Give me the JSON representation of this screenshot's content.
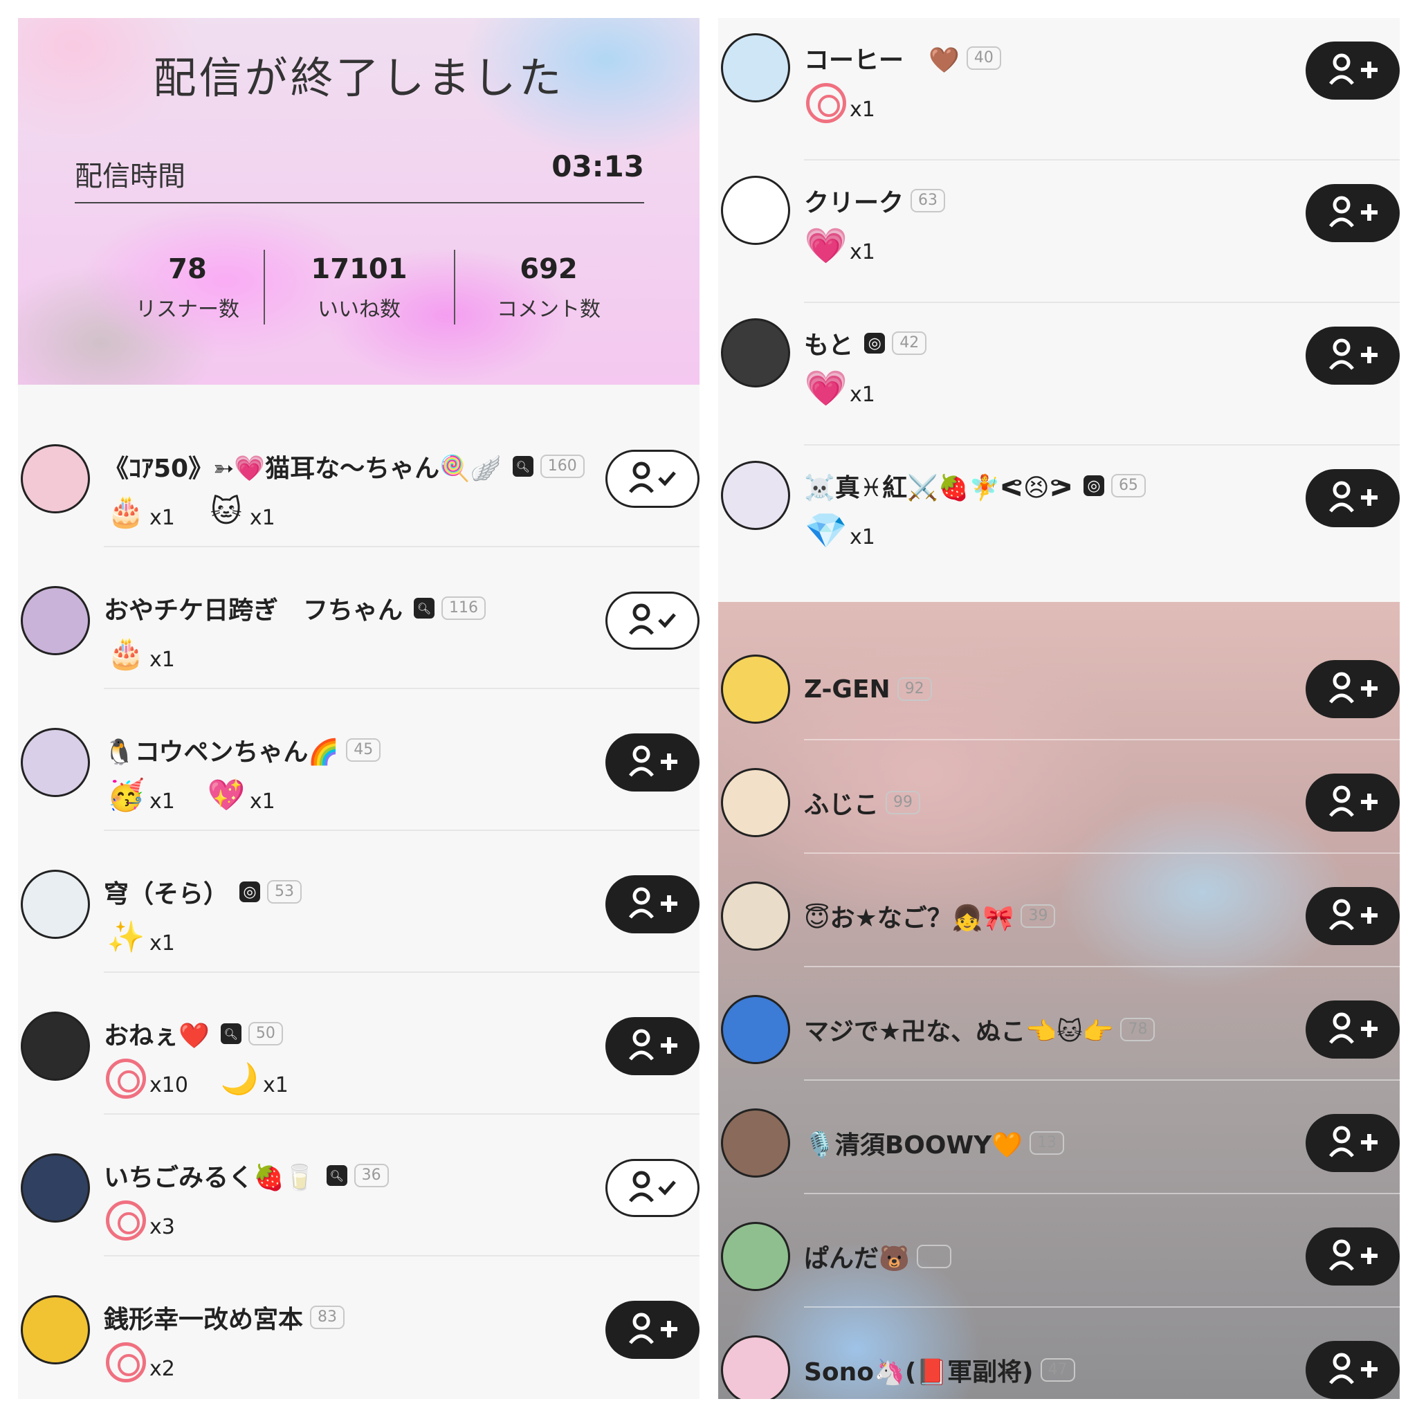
{
  "summary": {
    "title": "配信が終了しました",
    "duration_label": "配信時間",
    "duration_value": "03:13",
    "stats": [
      {
        "value": "78",
        "label": "リスナー数"
      },
      {
        "value": "17101",
        "label": "いいね数"
      },
      {
        "value": "692",
        "label": "コメント数"
      }
    ]
  },
  "left_listeners": [
    {
      "name": "《ｺｱ50》➳💗猫耳な～ちゃん🍭🪽",
      "badge": "Q",
      "level": "160",
      "following": true,
      "gifts": [
        {
          "icon": "🎂",
          "count": "x1"
        },
        {
          "icon": "🐱",
          "count": "x1"
        }
      ]
    },
    {
      "name": "おやチケ日跨ぎ　フちゃん",
      "badge": "Q",
      "level": "116",
      "following": true,
      "gifts": [
        {
          "icon": "🎂",
          "count": "x1"
        }
      ]
    },
    {
      "name": "🐧コウペンちゃん🌈",
      "badge": "",
      "level": "45",
      "following": false,
      "gifts": [
        {
          "icon": "🥳",
          "count": "x1"
        },
        {
          "icon": "💖",
          "count": "x1"
        }
      ]
    },
    {
      "name": "穹（そら）",
      "badge": "IG",
      "level": "53",
      "following": false,
      "gifts": [
        {
          "icon": "✨",
          "count": "x1"
        }
      ]
    },
    {
      "name": "おねぇ❤️",
      "badge": "Q",
      "level": "50",
      "following": false,
      "gifts": [
        {
          "icon": "rose",
          "count": "x10"
        },
        {
          "icon": "🌙",
          "count": "x1"
        }
      ]
    },
    {
      "name": "いちごみるく🍓🥛",
      "badge": "Q",
      "level": "36",
      "following": true,
      "gifts": [
        {
          "icon": "rose",
          "count": "x3"
        }
      ]
    },
    {
      "name": "銭形幸一改め宮本",
      "badge": "",
      "level": "83",
      "following": false,
      "gifts": [
        {
          "icon": "rose",
          "count": "x2"
        }
      ]
    }
  ],
  "right_listeners": [
    {
      "name": "コーヒー　🤎",
      "badge": "",
      "level": "40",
      "following": false,
      "gifts": [
        {
          "icon": "rose",
          "count": "x1"
        }
      ]
    },
    {
      "name": "クリーク",
      "badge": "",
      "level": "63",
      "following": false,
      "gifts": [
        {
          "icon": "💗",
          "count": "x1"
        }
      ]
    },
    {
      "name": "もと",
      "badge": "IG",
      "level": "42",
      "following": false,
      "gifts": [
        {
          "icon": "💗",
          "count": "x1"
        }
      ]
    },
    {
      "name": "☠️真♓紅⚔️🍓🧚ᕙ😣ᕗ",
      "badge": "IG",
      "level": "65",
      "following": false,
      "gifts": [
        {
          "icon": "💎",
          "count": "x1"
        }
      ]
    }
  ],
  "right_blurred_listeners": [
    {
      "name": "Z-GEN",
      "level": "92"
    },
    {
      "name": "ふじこ",
      "level": "99"
    },
    {
      "name": "😇お★なご？👧🎀",
      "level": "39"
    },
    {
      "name": "マジで★卍な、ぬこ👈🐱👉",
      "level": "78"
    },
    {
      "name": "🎙️清須BOOWY🧡",
      "level": "13"
    },
    {
      "name": "ぱんだ🐻",
      "level": "34"
    },
    {
      "name": "Sono🦄(📕軍副将)",
      "level": "47"
    }
  ],
  "icons": {
    "follow": "add-user-icon",
    "following": "user-check-icon",
    "badge_q": "search-badge-icon",
    "badge_ig": "instagram-icon",
    "rose": "rose-gift-icon"
  }
}
